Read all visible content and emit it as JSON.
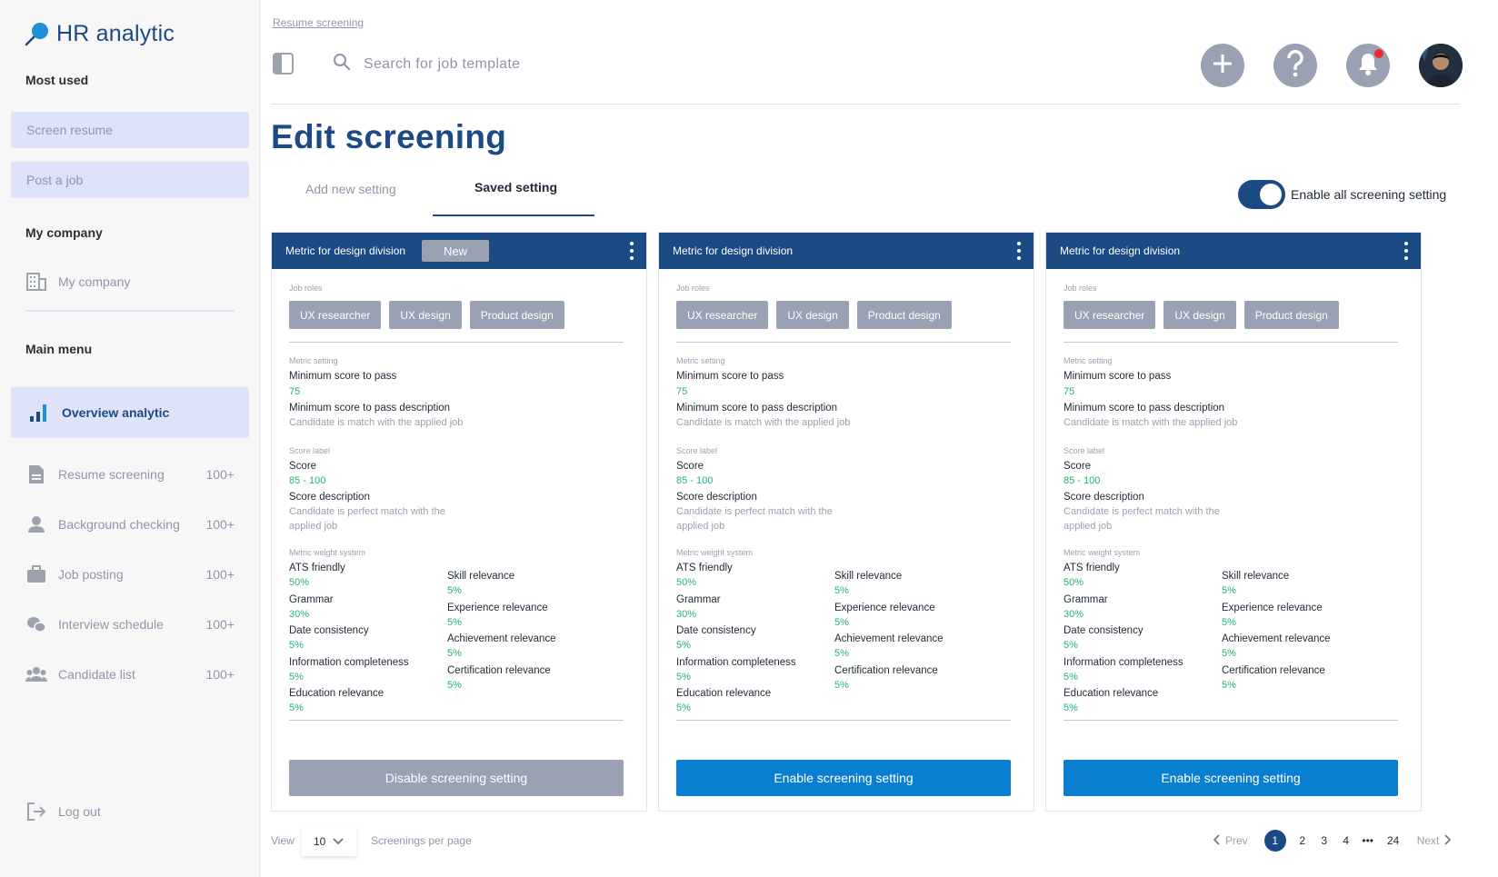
{
  "app": {
    "title": "HR analytic"
  },
  "sidebar": {
    "most_used_heading": "Most used",
    "most_used": [
      {
        "label": "Screen resume"
      },
      {
        "label": "Post a job"
      }
    ],
    "my_company_heading": "My company",
    "my_company_item": {
      "label": "My company",
      "icon": "building-icon"
    },
    "main_menu_heading": "Main menu",
    "active_item": {
      "label": "Overview analytic",
      "icon": "bar-chart-icon"
    },
    "items": [
      {
        "label": "Resume screening",
        "count": "100+",
        "icon": "document-icon"
      },
      {
        "label": "Background checking",
        "count": "100+",
        "icon": "person-icon"
      },
      {
        "label": "Job posting",
        "count": "100+",
        "icon": "briefcase-icon"
      },
      {
        "label": "Interview schedule",
        "count": "100+",
        "icon": "chat-icon"
      },
      {
        "label": "Candidate list",
        "count": "100+",
        "icon": "group-icon"
      }
    ],
    "logout": {
      "label": "Log out",
      "icon": "logout-icon"
    }
  },
  "header": {
    "breadcrumb": "Resume screening",
    "search_placeholder": "Search for job template"
  },
  "page": {
    "title": "Edit screening",
    "tabs": [
      {
        "label": "Add new setting",
        "active": false
      },
      {
        "label": "Saved setting",
        "active": true
      }
    ],
    "toggle_label": "Enable all screening setting",
    "toggle_on": true
  },
  "cards": [
    {
      "title": "Metric for design division",
      "badge": "New",
      "job_roles_label": "Job roles",
      "roles": [
        "UX researcher",
        "UX design",
        "Product design"
      ],
      "metric_setting_label": "Metric setting",
      "min_score_label": "Minimum score  to pass",
      "min_score_value": "75",
      "min_desc_label": "Minimum score to pass description",
      "min_desc_value": "Candidate is match with the applied job",
      "score_label_heading": "Score label",
      "score_label": "Score",
      "score_value": "85 - 100",
      "score_desc_label": "Score description",
      "score_desc_line1": "Candidate is perfect match with the",
      "score_desc_line2": "applied job",
      "weight_label": "Metric weight system",
      "weights_left": [
        {
          "name": "ATS friendly",
          "value": "50%"
        },
        {
          "name": "Grammar",
          "value": "30%"
        },
        {
          "name": "Date consistency",
          "value": "5%"
        },
        {
          "name": "Information completeness",
          "value": "5%"
        },
        {
          "name": "Education relevance",
          "value": "5%"
        }
      ],
      "weights_right": [
        {
          "name": "Skill relevance",
          "value": "5%"
        },
        {
          "name": "Experience relevance",
          "value": "5%"
        },
        {
          "name": "Achievement relevance",
          "value": "5%"
        },
        {
          "name": "Certification relevance",
          "value": "5%"
        }
      ],
      "button": "Disable screening setting"
    },
    {
      "title": "Metric for design division",
      "badge": "",
      "job_roles_label": "Job roles",
      "roles": [
        "UX researcher",
        "UX design",
        "Product design"
      ],
      "metric_setting_label": "Metric setting",
      "min_score_label": "Minimum score  to pass",
      "min_score_value": "75",
      "min_desc_label": "Minimum score to pass description",
      "min_desc_value": "Candidate is match with the applied job",
      "score_label_heading": "Score label",
      "score_label": "Score",
      "score_value": "85 - 100",
      "score_desc_label": "Score description",
      "score_desc_line1": "Candidate is perfect match with the",
      "score_desc_line2": "applied job",
      "weight_label": "Metric weight system",
      "weights_left": [
        {
          "name": "ATS friendly",
          "value": "50%"
        },
        {
          "name": "Grammar",
          "value": "30%"
        },
        {
          "name": "Date consistency",
          "value": "5%"
        },
        {
          "name": "Information completeness",
          "value": "5%"
        },
        {
          "name": "Education relevance",
          "value": "5%"
        }
      ],
      "weights_right": [
        {
          "name": "Skill relevance",
          "value": "5%"
        },
        {
          "name": "Experience relevance",
          "value": "5%"
        },
        {
          "name": "Achievement relevance",
          "value": "5%"
        },
        {
          "name": "Certification relevance",
          "value": "5%"
        }
      ],
      "button": "Enable screening setting"
    },
    {
      "title": "Metric for design division",
      "badge": "",
      "job_roles_label": "Job roles",
      "roles": [
        "UX researcher",
        "UX design",
        "Product design"
      ],
      "metric_setting_label": "Metric setting",
      "min_score_label": "Minimum score  to pass",
      "min_score_value": "75",
      "min_desc_label": "Minimum score to pass description",
      "min_desc_value": "Candidate is match with the applied job",
      "score_label_heading": "Score label",
      "score_label": "Score",
      "score_value": "85 - 100",
      "score_desc_label": "Score description",
      "score_desc_line1": "Candidate is perfect match with the",
      "score_desc_line2": "applied job",
      "weight_label": "Metric weight system",
      "weights_left": [
        {
          "name": "ATS friendly",
          "value": "50%"
        },
        {
          "name": "Grammar",
          "value": "30%"
        },
        {
          "name": "Date consistency",
          "value": "5%"
        },
        {
          "name": "Information completeness",
          "value": "5%"
        },
        {
          "name": "Education relevance",
          "value": "5%"
        }
      ],
      "weights_right": [
        {
          "name": "Skill relevance",
          "value": "5%"
        },
        {
          "name": "Experience relevance",
          "value": "5%"
        },
        {
          "name": "Achievement relevance",
          "value": "5%"
        },
        {
          "name": "Certification relevance",
          "value": "5%"
        }
      ],
      "button": "Enable screening setting"
    }
  ],
  "footer": {
    "view_label": "View",
    "view_value": "10",
    "per_page_label": "Screenings per page",
    "prev": "Prev",
    "next": "Next",
    "pages": [
      "1",
      "2",
      "3",
      "4",
      "•••",
      "24"
    ],
    "current_page": "1"
  },
  "colors": {
    "primary": "#1c4a85",
    "accent": "#0a7fd1",
    "success": "#22b573",
    "muted": "#99a1b3",
    "sidebar_highlight": "#dfe3fa"
  }
}
